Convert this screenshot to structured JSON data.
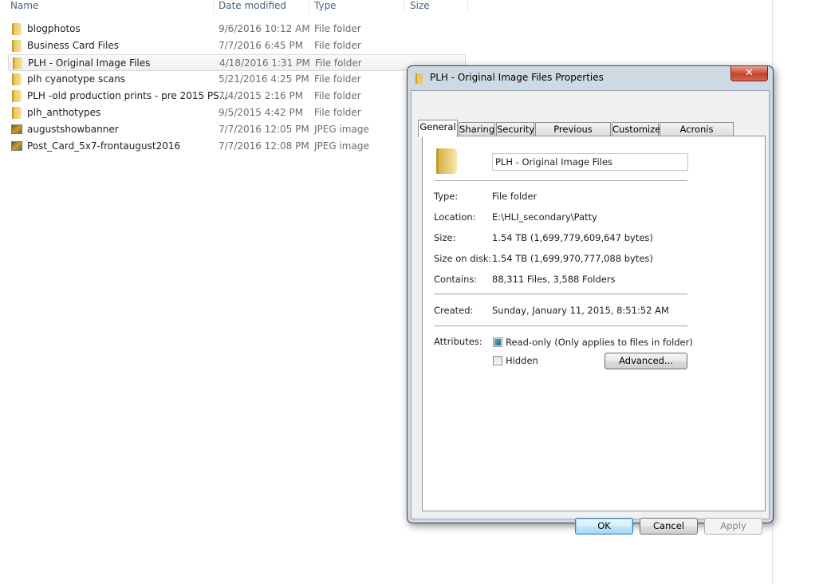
{
  "explorer": {
    "columns": [
      "Name",
      "Date modified",
      "Type",
      "Size"
    ],
    "rows": [
      {
        "name": "blogphotos",
        "date": "9/6/2016 10:12 AM",
        "type": "File folder",
        "icon": "folder-icon"
      },
      {
        "name": "Business Card Files",
        "date": "7/7/2016 6:45 PM",
        "type": "File folder",
        "icon": "folder-icon"
      },
      {
        "name": "PLH - Original Image Files",
        "date": "4/18/2016 1:31 PM",
        "type": "File folder",
        "icon": "folder-icon",
        "selected": true
      },
      {
        "name": "plh cyanotype scans",
        "date": "5/21/2016 4:25 PM",
        "type": "File folder",
        "icon": "folder-icon"
      },
      {
        "name": "PLH -old production prints - pre 2015 PS...",
        "date": "7/4/2015 2:16 PM",
        "type": "File folder",
        "icon": "folder-icon"
      },
      {
        "name": "plh_anthotypes",
        "date": "9/5/2015 4:42 PM",
        "type": "File folder",
        "icon": "folder-icon"
      },
      {
        "name": "augustshowbanner",
        "date": "7/7/2016 12:05 PM",
        "type": "JPEG image",
        "icon": "jpeg-image-icon"
      },
      {
        "name": "Post_Card_5x7-frontaugust2016",
        "date": "7/7/2016 12:08 PM",
        "type": "JPEG image",
        "icon": "jpeg-image-icon"
      }
    ]
  },
  "dialog": {
    "title": "PLH - Original Image Files Properties",
    "close": "✕",
    "tabs": [
      "General",
      "Sharing",
      "Security",
      "Previous Versions",
      "Customize",
      "Acronis Recovery"
    ],
    "active_tab": "General",
    "folder_name": "PLH - Original Image Files",
    "fields": [
      {
        "label": "Type:",
        "value": "File folder"
      },
      {
        "label": "Location:",
        "value": "E:\\HLI_secondary\\Patty"
      },
      {
        "label": "Size:",
        "value": "1.54 TB (1,699,779,609,647 bytes)"
      },
      {
        "label": "Size on disk:",
        "value": "1.54 TB (1,699,970,777,088 bytes)"
      },
      {
        "label": "Contains:",
        "value": "88,311 Files, 3,588 Folders"
      }
    ],
    "created": {
      "label": "Created:",
      "value": "Sunday, January 11, 2015, 8:51:52 AM"
    },
    "attributes": {
      "label": "Attributes:",
      "readonly": {
        "label": "Read-only (Only applies to files in folder)",
        "state": "indeterminate"
      },
      "hidden": {
        "label": "Hidden",
        "state": "unchecked"
      },
      "advanced": "Advanced..."
    },
    "buttons": {
      "ok": "OK",
      "cancel": "Cancel",
      "apply": "Apply"
    }
  }
}
